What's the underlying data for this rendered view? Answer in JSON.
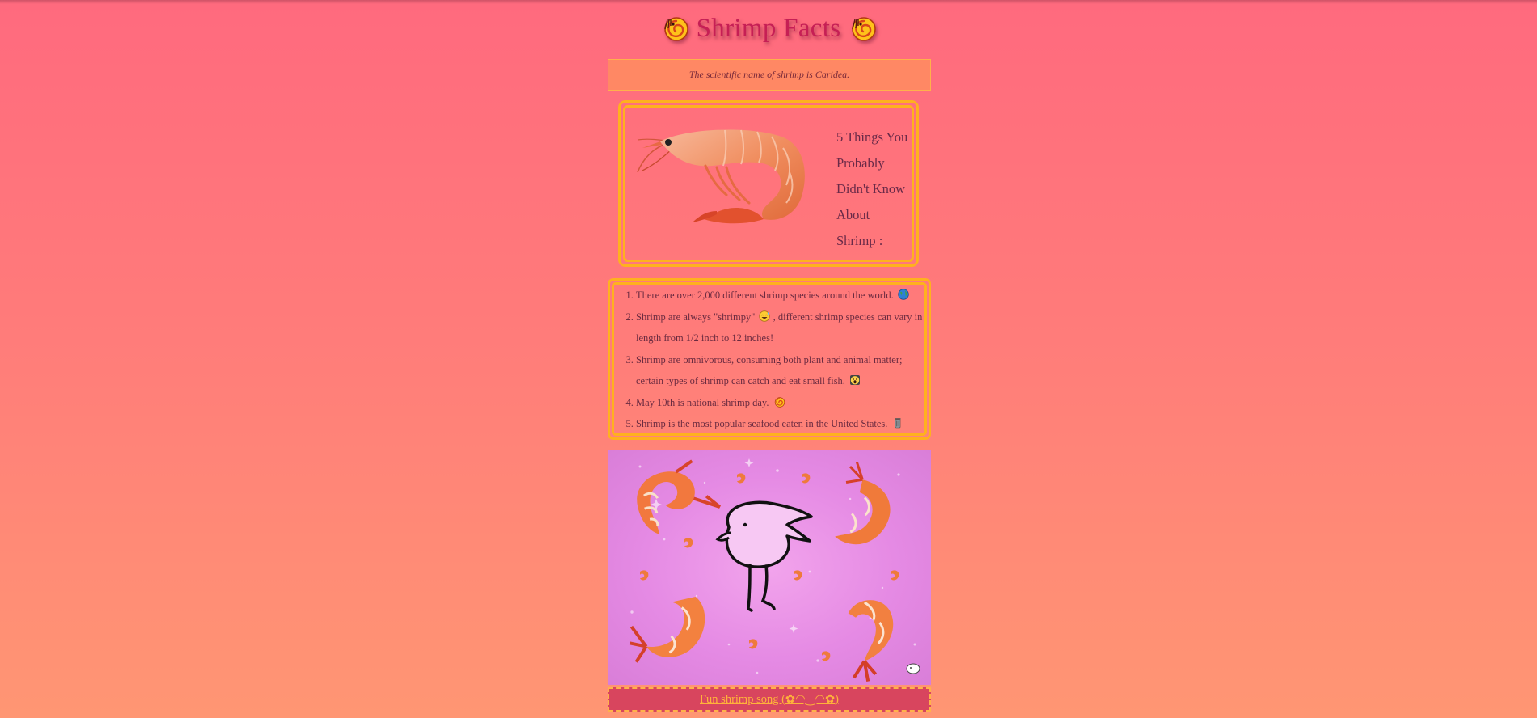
{
  "header": {
    "title": "Shrimp Facts",
    "left_icon": "shrimp-emoji-icon",
    "right_icon": "shrimp-emoji-icon"
  },
  "scientific_note": "The scientific name of shrimp is Caridea.",
  "intro_card": {
    "image": "shrimp-photo",
    "lines": [
      "5 Things You",
      "Probably",
      "Didn't Know",
      "About",
      "Shrimp :"
    ]
  },
  "facts": [
    {
      "text": "There are over 2,000 different shrimp species around the world.",
      "icon": "globe-emoji-icon"
    },
    {
      "text_before": "Shrimp are always \"shrimpy\"",
      "icon": "grinning-sweat-emoji-icon",
      "text_after": ", different shrimp species can vary in length from 1/2 inch to 12 inches!"
    },
    {
      "text": "Shrimp are omnivorous, consuming both plant and animal matter; certain types of shrimp can catch and eat small fish.",
      "icon": "screaming-face-emoji-icon"
    },
    {
      "text": "May 10th is national shrimp day.",
      "icon": "shrimp-emoji-icon"
    },
    {
      "text": "Shrimp is the most popular seafood eaten in the United States.",
      "icon": "trash-can-emoji-icon"
    }
  ],
  "video": {
    "description_icon": "dancing-bird-shrimp-animation"
  },
  "song_link": {
    "label": "Fun shrimp song (✿◠‿◠✿)"
  },
  "colors": {
    "title": "#c61f55",
    "border_accent": "#ffb11e",
    "link": "#ffb33a",
    "song_bar": "#d8455e"
  }
}
